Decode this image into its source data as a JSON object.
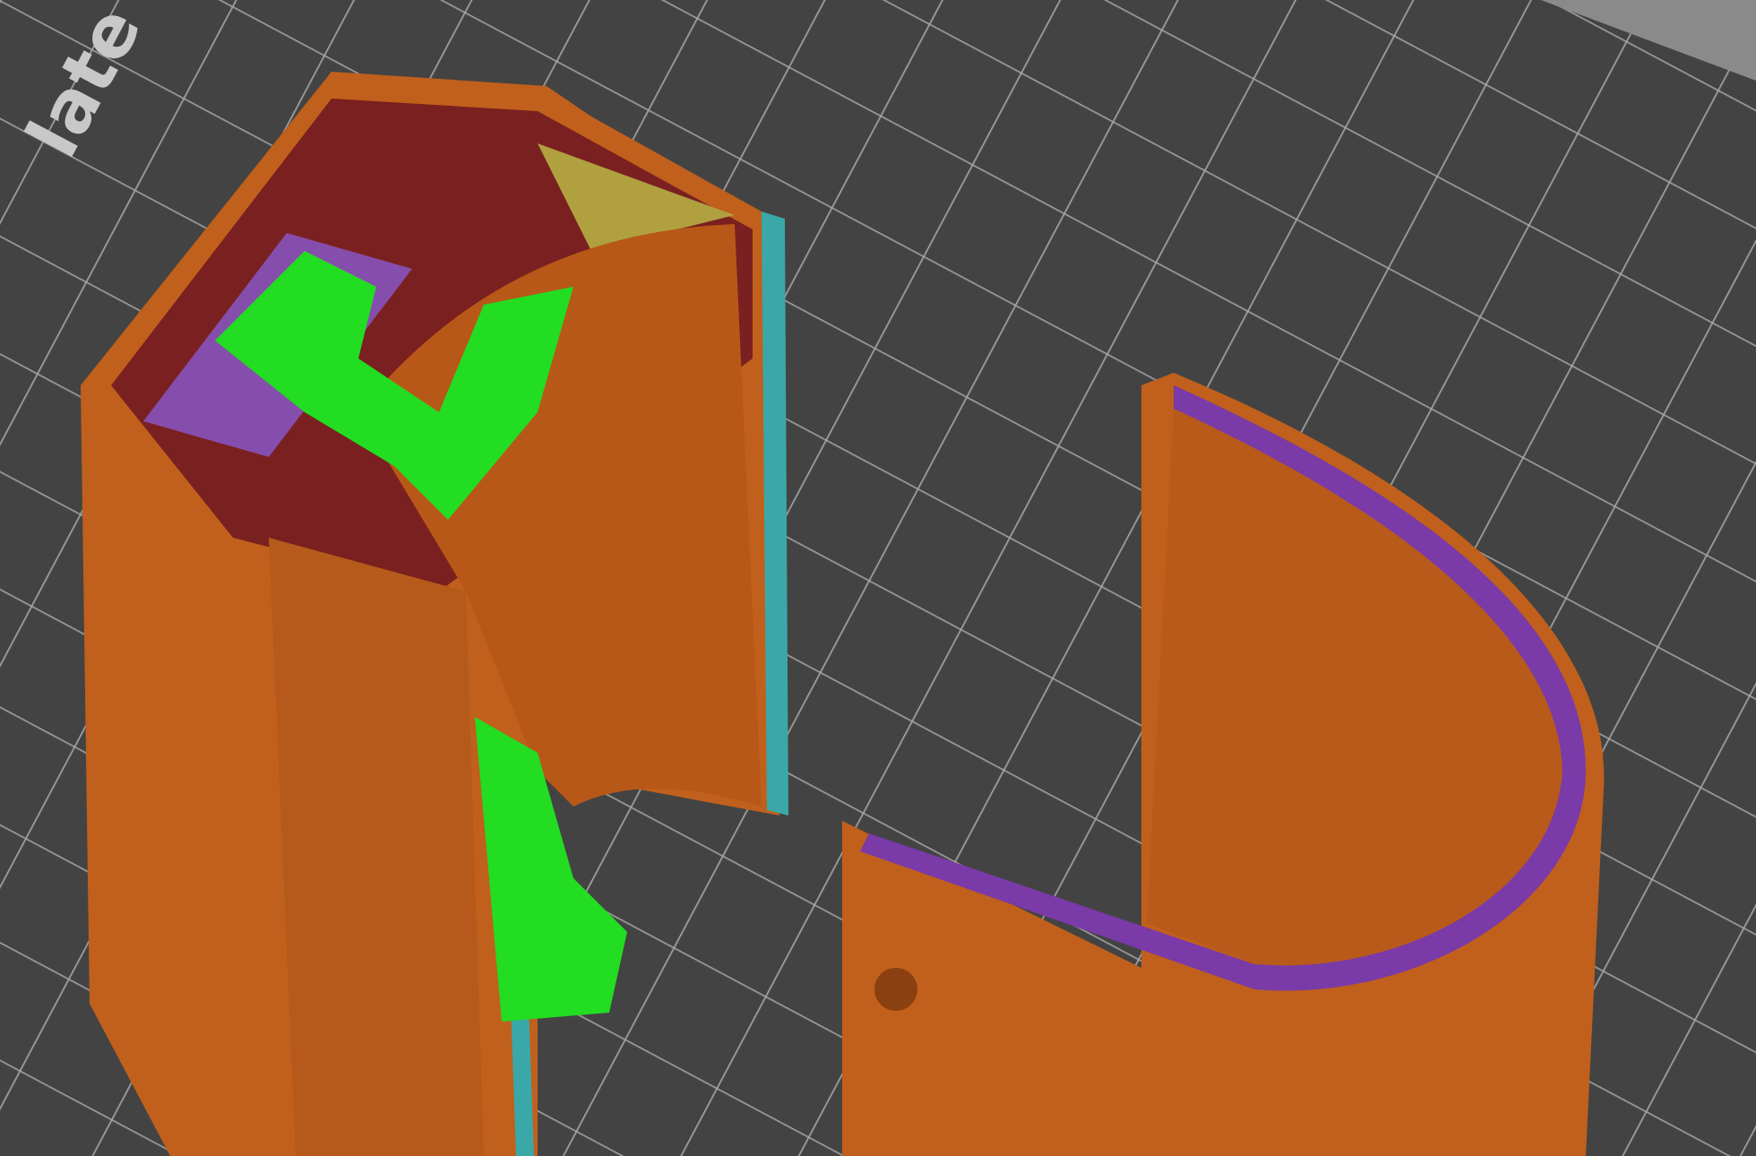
{
  "viewport": {
    "bed_label": "late"
  }
}
